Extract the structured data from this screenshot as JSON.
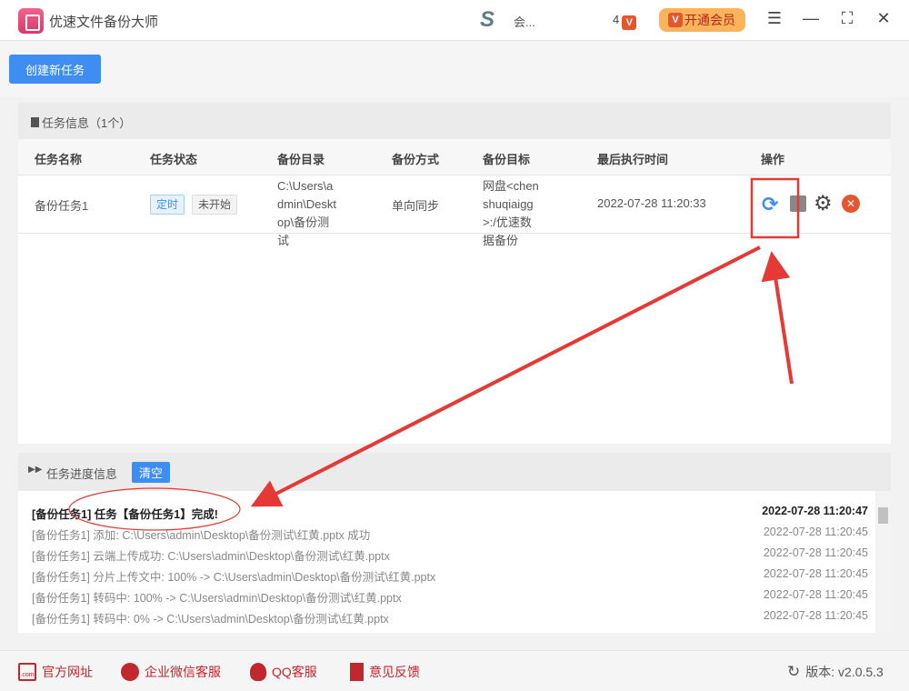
{
  "app": {
    "title": "优速文件备份大师",
    "user": "会...",
    "vip_count": "4",
    "vip_badge": "V",
    "vip_button": "开通会员"
  },
  "window": {
    "menu": "☰",
    "minimize": "—",
    "maximize": "⛶",
    "close": "✕"
  },
  "toolbar": {
    "new_task": "创建新任务"
  },
  "tasks": {
    "header": "任务信息（1个）",
    "columns": [
      "任务名称",
      "任务状态",
      "备份目录",
      "备份方式",
      "备份目标",
      "最后执行时间",
      "操作"
    ],
    "rows": [
      {
        "name": "备份任务1",
        "tag_schedule": "定时",
        "tag_status": "未开始",
        "dir": "C:\\Users\\admin\\Desktop\\备份测试",
        "mode": "单向同步",
        "target": "网盘<chenshuqiaigg>:/优速数据备份",
        "last_run": "2022-07-28 11:20:33"
      }
    ]
  },
  "progress": {
    "header": "任务进度信息",
    "clear": "清空",
    "logs": [
      {
        "text": "[备份任务1] 任务【备份任务1】完成!",
        "time": "2022-07-28 11:20:47"
      },
      {
        "text": "[备份任务1] 添加:   C:\\Users\\admin\\Desktop\\备份测试\\红黄.pptx 成功",
        "time": "2022-07-28 11:20:45"
      },
      {
        "text": "[备份任务1] 云端上传成功: C:\\Users\\admin\\Desktop\\备份测试\\红黄.pptx",
        "time": "2022-07-28 11:20:45"
      },
      {
        "text": "[备份任务1] 分片上传文中: 100% -> C:\\Users\\admin\\Desktop\\备份测试\\红黄.pptx",
        "time": "2022-07-28 11:20:45"
      },
      {
        "text": "[备份任务1] 转码中: 100% -> C:\\Users\\admin\\Desktop\\备份测试\\红黄.pptx",
        "time": "2022-07-28 11:20:45"
      },
      {
        "text": "[备份任务1] 转码中: 0% -> C:\\Users\\admin\\Desktop\\备份测试\\红黄.pptx",
        "time": "2022-07-28 11:20:45"
      }
    ]
  },
  "footer": {
    "website": "官方网址",
    "wechat": "企业微信客服",
    "qq": "QQ客服",
    "feedback": "意见反馈",
    "version": "版本: v2.0.5.3",
    "com": ".com"
  },
  "colors": {
    "accent": "#3d8ef0",
    "danger": "#e4572e",
    "annotation": "#e53935"
  }
}
